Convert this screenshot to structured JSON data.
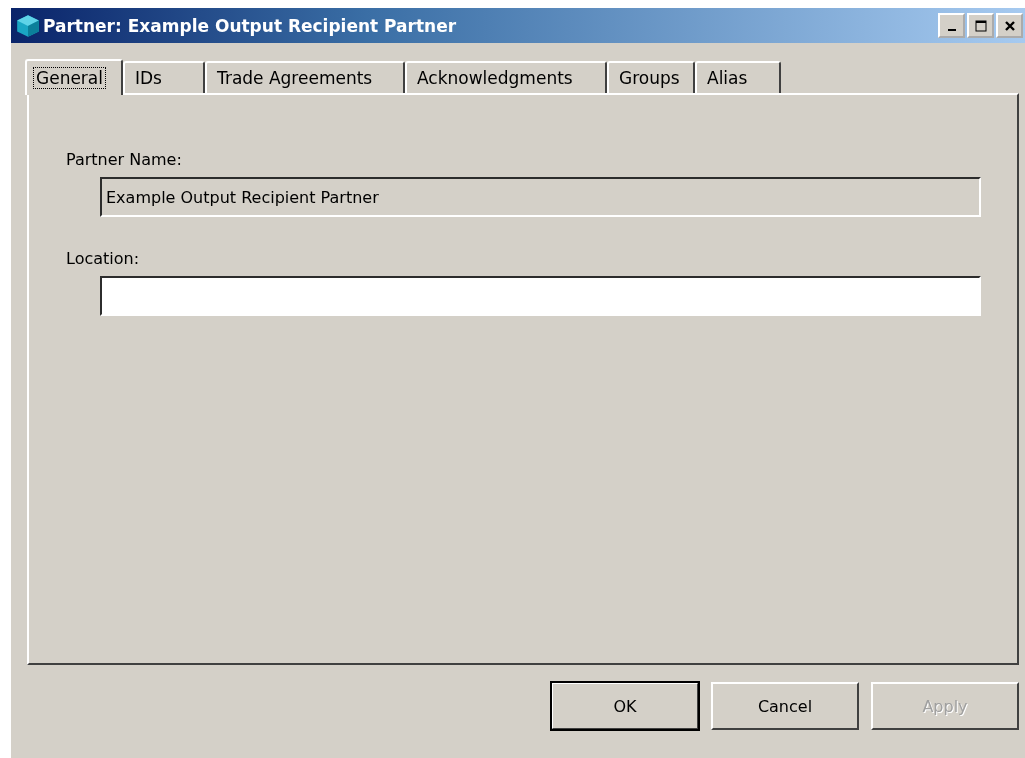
{
  "window": {
    "title": "Partner: Example Output Recipient Partner"
  },
  "title_buttons": [
    {
      "kind": "minimize"
    },
    {
      "kind": "maximize"
    },
    {
      "kind": "close"
    }
  ],
  "tabs": [
    {
      "label": "General",
      "selected": true
    },
    {
      "label": "IDs",
      "selected": false
    },
    {
      "label": "Trade Agreements",
      "selected": false
    },
    {
      "label": "Acknowledgments",
      "selected": false
    },
    {
      "label": "Groups",
      "selected": false
    },
    {
      "label": "Alias",
      "selected": false
    }
  ],
  "fields": [
    {
      "label": "Partner Name:",
      "value": "Example Output Recipient Partner",
      "disabled": true
    },
    {
      "label": "Location:",
      "disabled": false
    }
  ],
  "buttons": [
    {
      "label": "OK",
      "default": true,
      "disabled": false
    },
    {
      "label": "Cancel",
      "default": false,
      "disabled": false
    },
    {
      "label": "Apply",
      "default": false,
      "disabled": true
    }
  ]
}
